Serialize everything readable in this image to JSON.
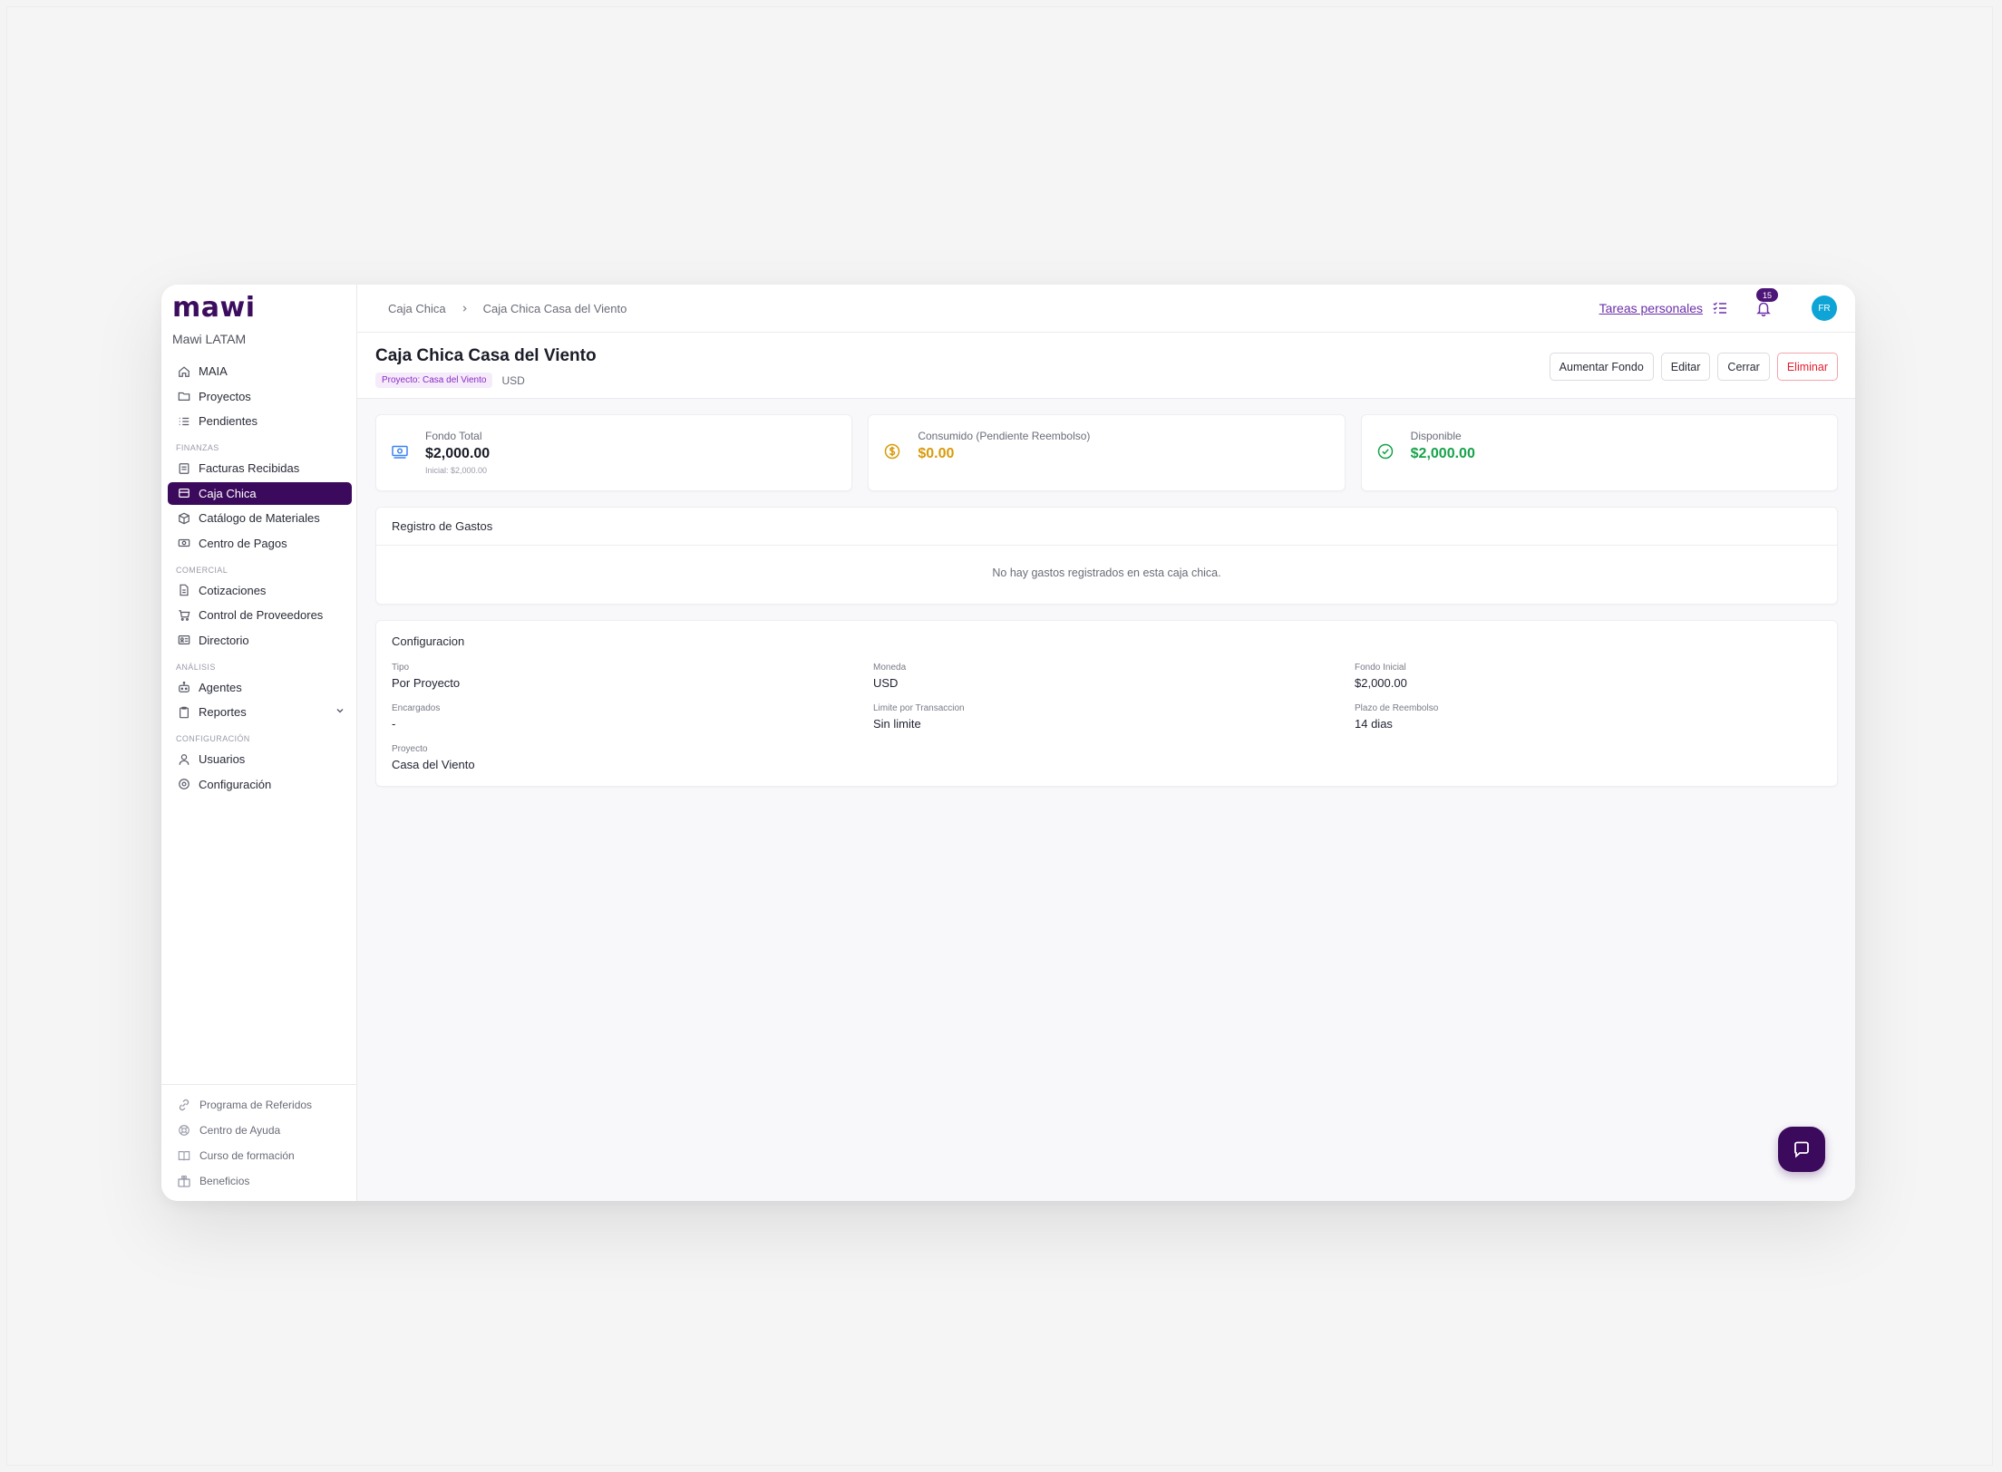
{
  "app": {
    "logo": "mawi",
    "org": "Mawi LATAM"
  },
  "nav": {
    "top_items": [
      {
        "label": "MAIA",
        "icon": "home-icon"
      },
      {
        "label": "Proyectos",
        "icon": "folder-icon"
      },
      {
        "label": "Pendientes",
        "icon": "list-icon"
      }
    ],
    "sections": [
      {
        "title": "FINANZAS",
        "items": [
          {
            "label": "Facturas Recibidas",
            "icon": "invoice-icon"
          },
          {
            "label": "Caja Chica",
            "icon": "cashbox-icon",
            "active": true
          },
          {
            "label": "Catálogo de Materiales",
            "icon": "cube-icon"
          },
          {
            "label": "Centro de Pagos",
            "icon": "money-icon"
          }
        ]
      },
      {
        "title": "COMERCIAL",
        "items": [
          {
            "label": "Cotizaciones",
            "icon": "document-icon"
          },
          {
            "label": "Control de Proveedores",
            "icon": "cart-icon"
          },
          {
            "label": "Directorio",
            "icon": "contacts-icon"
          }
        ]
      },
      {
        "title": "ANÁLISIS",
        "items": [
          {
            "label": "Agentes",
            "icon": "robot-icon"
          },
          {
            "label": "Reportes",
            "icon": "clipboard-icon"
          }
        ]
      },
      {
        "title": "CONFIGURACIÓN",
        "items": [
          {
            "label": "Usuarios",
            "icon": "user-icon"
          },
          {
            "label": "Configuración",
            "icon": "gear-icon"
          }
        ]
      }
    ],
    "bottom_items": [
      {
        "label": "Programa de Referidos",
        "icon": "link-icon"
      },
      {
        "label": "Centro de Ayuda",
        "icon": "lifebuoy-icon"
      },
      {
        "label": "Curso de formación",
        "icon": "book-icon"
      },
      {
        "label": "Beneficios",
        "icon": "gift-icon"
      }
    ]
  },
  "topbar": {
    "breadcrumb": [
      "Caja Chica",
      "Caja Chica Casa del Viento"
    ],
    "tasks_link": "Tareas personales",
    "notifications_count": "15",
    "avatar_initials": "FR"
  },
  "header": {
    "title": "Caja Chica Casa del Viento",
    "project_badge": "Proyecto: Casa del Viento",
    "currency": "USD",
    "actions": {
      "increase": "Aumentar Fondo",
      "edit": "Editar",
      "close": "Cerrar",
      "delete": "Eliminar"
    }
  },
  "stats": {
    "total": {
      "label": "Fondo Total",
      "value": "$2,000.00",
      "sub": "Inicial: $2,000.00",
      "color": "#1a1c28"
    },
    "consumed": {
      "label": "Consumido (Pendiente Reembolso)",
      "value": "$0.00",
      "color": "#d99a0b"
    },
    "available": {
      "label": "Disponible",
      "value": "$2,000.00",
      "color": "#16a34a"
    }
  },
  "expenses": {
    "title": "Registro de Gastos",
    "empty_text": "No hay gastos registrados en esta caja chica."
  },
  "config": {
    "title": "Configuracion",
    "fields": {
      "tipo": {
        "label": "Tipo",
        "value": "Por Proyecto"
      },
      "moneda": {
        "label": "Moneda",
        "value": "USD"
      },
      "fondo_inicial": {
        "label": "Fondo Inicial",
        "value": "$2,000.00"
      },
      "encargados": {
        "label": "Encargados",
        "value": "-"
      },
      "limite": {
        "label": "Limite por Transaccion",
        "value": "Sin limite"
      },
      "plazo": {
        "label": "Plazo de Reembolso",
        "value": "14 dias"
      },
      "proyecto": {
        "label": "Proyecto",
        "value": "Casa del Viento"
      }
    }
  },
  "colors": {
    "brand": "#3c0a5c",
    "accent": "#6b2fa8",
    "danger": "#e11d2e",
    "success": "#16a34a",
    "warning": "#d99a0b",
    "info": "#0ea5d6"
  }
}
